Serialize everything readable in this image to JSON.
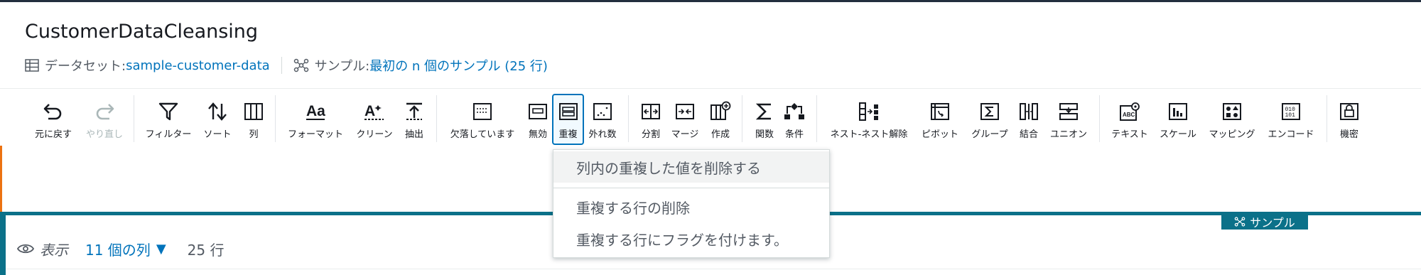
{
  "header": {
    "title": "CustomerDataCleansing",
    "dataset_label": "データセット: ",
    "dataset_value": "sample-customer-data",
    "sample_label": "サンプル: ",
    "sample_value": "最初の n 個のサンプル (25 行)"
  },
  "toolbar": {
    "undo": "元に戻す",
    "redo": "やり直し",
    "filter": "フィルター",
    "sort": "ソート",
    "column": "列",
    "format": "フォーマット",
    "clean": "クリーン",
    "extract": "抽出",
    "missing": "欠落しています",
    "invalid": "無効",
    "duplicate": "重複",
    "outlier": "外れ数",
    "split": "分割",
    "merge": "マージ",
    "create": "作成",
    "function": "関数",
    "condition": "条件",
    "nest": "ネスト-ネスト解除",
    "pivot": "ピボット",
    "group": "グループ",
    "join": "結合",
    "union": "ユニオン",
    "text": "テキスト",
    "scale": "スケール",
    "mapping": "マッピング",
    "encode": "エンコード",
    "sensitive": "機密"
  },
  "dropdown": {
    "item1": "列内の重複した値を削除する",
    "item2": "重複する行の削除",
    "item3": "重複する行にフラグを付けます。"
  },
  "grid": {
    "sample_tab": "サンプル",
    "view_label": "表示",
    "columns": "11 個の列",
    "rows": "25 行"
  },
  "colors": {
    "accent": "#0073bb",
    "teal": "#0b7189",
    "orange": "#ec7211"
  }
}
